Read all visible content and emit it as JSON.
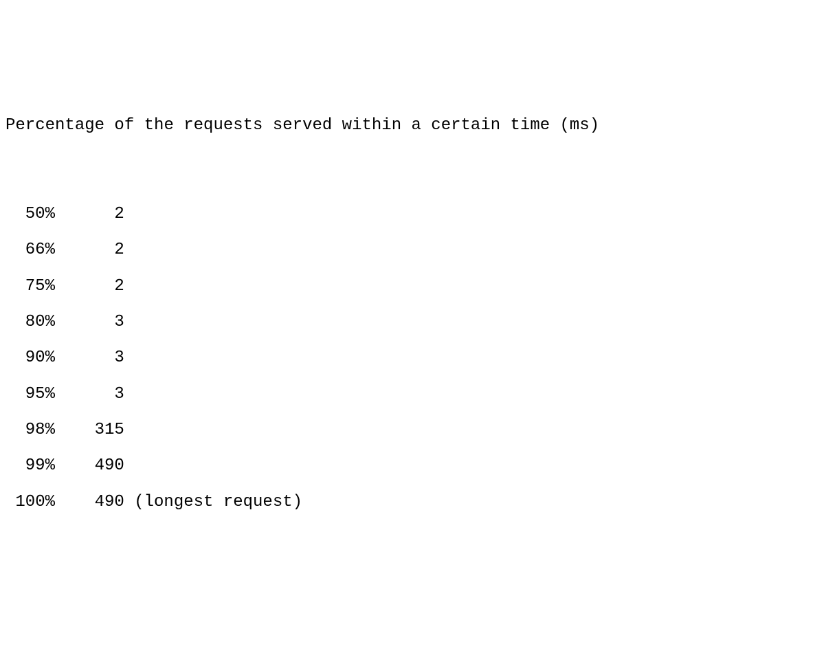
{
  "header": "Percentage of the requests served within a certain time (ms)",
  "rows": [
    {
      "percent": "50%",
      "value": "2",
      "note": ""
    },
    {
      "percent": "66%",
      "value": "2",
      "note": ""
    },
    {
      "percent": "75%",
      "value": "2",
      "note": ""
    },
    {
      "percent": "80%",
      "value": "3",
      "note": ""
    },
    {
      "percent": "90%",
      "value": "3",
      "note": ""
    },
    {
      "percent": "95%",
      "value": "3",
      "note": ""
    },
    {
      "percent": "98%",
      "value": "315",
      "note": ""
    },
    {
      "percent": "99%",
      "value": "490",
      "note": ""
    },
    {
      "percent": "100%",
      "value": "490",
      "note": "(longest request)"
    }
  ]
}
